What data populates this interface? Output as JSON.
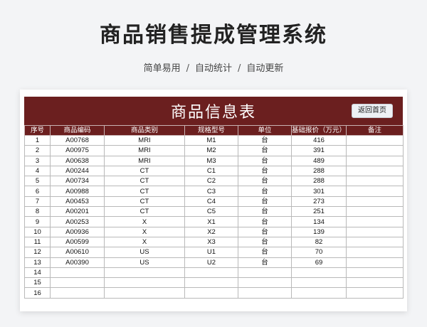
{
  "header": {
    "title": "商品销售提成管理系统",
    "tags": [
      "简单易用",
      "自动统计",
      "自动更新"
    ]
  },
  "sheet": {
    "title": "商品信息表",
    "back_button": "返回首页",
    "columns": [
      "序号",
      "商品编码",
      "商品类别",
      "规格型号",
      "单位",
      "基础报价（万元）",
      "备注"
    ],
    "rows": [
      [
        "1",
        "A00768",
        "MRI",
        "M1",
        "台",
        "416",
        ""
      ],
      [
        "2",
        "A00975",
        "MRI",
        "M2",
        "台",
        "391",
        ""
      ],
      [
        "3",
        "A00638",
        "MRI",
        "M3",
        "台",
        "489",
        ""
      ],
      [
        "4",
        "A00244",
        "CT",
        "C1",
        "台",
        "288",
        ""
      ],
      [
        "5",
        "A00734",
        "CT",
        "C2",
        "台",
        "288",
        ""
      ],
      [
        "6",
        "A00988",
        "CT",
        "C3",
        "台",
        "301",
        ""
      ],
      [
        "7",
        "A00453",
        "CT",
        "C4",
        "台",
        "273",
        ""
      ],
      [
        "8",
        "A00201",
        "CT",
        "C5",
        "台",
        "251",
        ""
      ],
      [
        "9",
        "A00253",
        "X",
        "X1",
        "台",
        "134",
        ""
      ],
      [
        "10",
        "A00936",
        "X",
        "X2",
        "台",
        "139",
        ""
      ],
      [
        "11",
        "A00599",
        "X",
        "X3",
        "台",
        "82",
        ""
      ],
      [
        "12",
        "A00610",
        "US",
        "U1",
        "台",
        "70",
        ""
      ],
      [
        "13",
        "A00390",
        "US",
        "U2",
        "台",
        "69",
        ""
      ],
      [
        "14",
        "",
        "",
        "",
        "",
        "",
        ""
      ],
      [
        "15",
        "",
        "",
        "",
        "",
        "",
        ""
      ],
      [
        "16",
        "",
        "",
        "",
        "",
        "",
        ""
      ]
    ]
  },
  "colors": {
    "banner": "#6b1f1f",
    "background": "#f3f4f6"
  }
}
